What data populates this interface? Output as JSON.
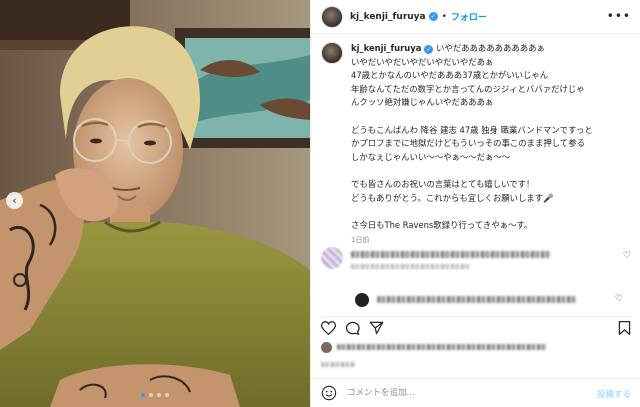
{
  "post": {
    "username": "kj_kenji_furuya",
    "follow_label": "フォロー",
    "separator": "•",
    "more_icon": "more-horizontal-icon",
    "caption_lines": [
      "いやだあああああああああぁ",
      "いやだいやだいやだいやだいやだあぁ",
      "47歳とかなんのいやだあああ37歳とかがいいじゃん",
      "年齢なんてただの数字とか言ってんのジジィとババァだけじゃ",
      "んクッソ絶対嫌じゃんいやだあああぁ",
      "",
      "どうもこんばんわ 降谷 建志 47歳 独身 職業バンドマンですっと",
      "かプロフまでに地獄だけどもういっその事このまま押して参る",
      "しかなぇじゃんいい〜〜やぁ〜〜だぁ〜〜",
      "",
      "でも皆さんのお祝いの言葉はとても嬉しいです！",
      "どうもありがとう。これからも宜しくお願いします🎤",
      "",
      "さ今日もThe Ravens歌録り行ってきやぁ〜す。"
    ],
    "time_ago": "1日前"
  },
  "comment_box": {
    "placeholder": "コメントを追加...",
    "post_label": "投稿する"
  },
  "icons": {
    "verified": "verified-badge-icon",
    "like": "heart-icon",
    "comment": "comment-icon",
    "share": "share-icon",
    "save": "bookmark-icon",
    "emoji": "emoji-icon",
    "carousel_prev": "chevron-left-icon"
  },
  "carousel": {
    "slides": 4,
    "active_index": 0
  },
  "colors": {
    "accent": "#0095f6",
    "verified": "#3897f0",
    "post_disabled": "#b2dffc"
  }
}
